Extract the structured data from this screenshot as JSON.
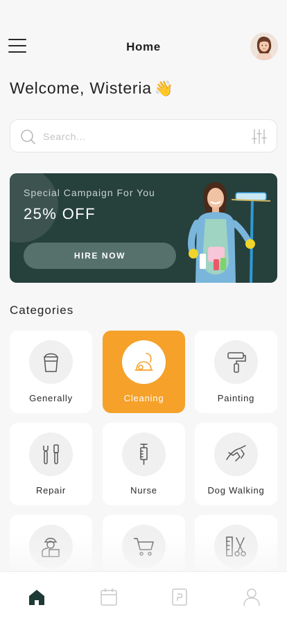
{
  "header": {
    "title": "Home"
  },
  "welcome": {
    "text": "Welcome, Wisteria",
    "emoji": "👋"
  },
  "search": {
    "placeholder": "Search..."
  },
  "banner": {
    "subtitle": "Special Campaign For You",
    "discount": "25% OFF",
    "cta": "HIRE NOW"
  },
  "categories": {
    "title": "Categories",
    "items": [
      {
        "label": "Generally",
        "icon": "bucket-icon",
        "active": false
      },
      {
        "label": "Cleaning",
        "icon": "vacuum-icon",
        "active": true
      },
      {
        "label": "Painting",
        "icon": "paint-roller-icon",
        "active": false
      },
      {
        "label": "Repair",
        "icon": "tools-icon",
        "active": false
      },
      {
        "label": "Nurse",
        "icon": "syringe-icon",
        "active": false
      },
      {
        "label": "Dog Walking",
        "icon": "dog-leash-icon",
        "active": false
      },
      {
        "label": "",
        "icon": "delivery-person-icon",
        "active": false
      },
      {
        "label": "",
        "icon": "shopping-cart-icon",
        "active": false
      },
      {
        "label": "",
        "icon": "sewing-scissors-icon",
        "active": false
      }
    ]
  },
  "tabs": [
    {
      "icon": "home-icon",
      "active": true
    },
    {
      "icon": "calendar-icon",
      "active": false
    },
    {
      "icon": "booking-icon",
      "active": false
    },
    {
      "icon": "profile-icon",
      "active": false
    }
  ],
  "colors": {
    "accent": "#f5a12a",
    "banner": "#26403c",
    "primary_dark": "#1d3a36"
  }
}
